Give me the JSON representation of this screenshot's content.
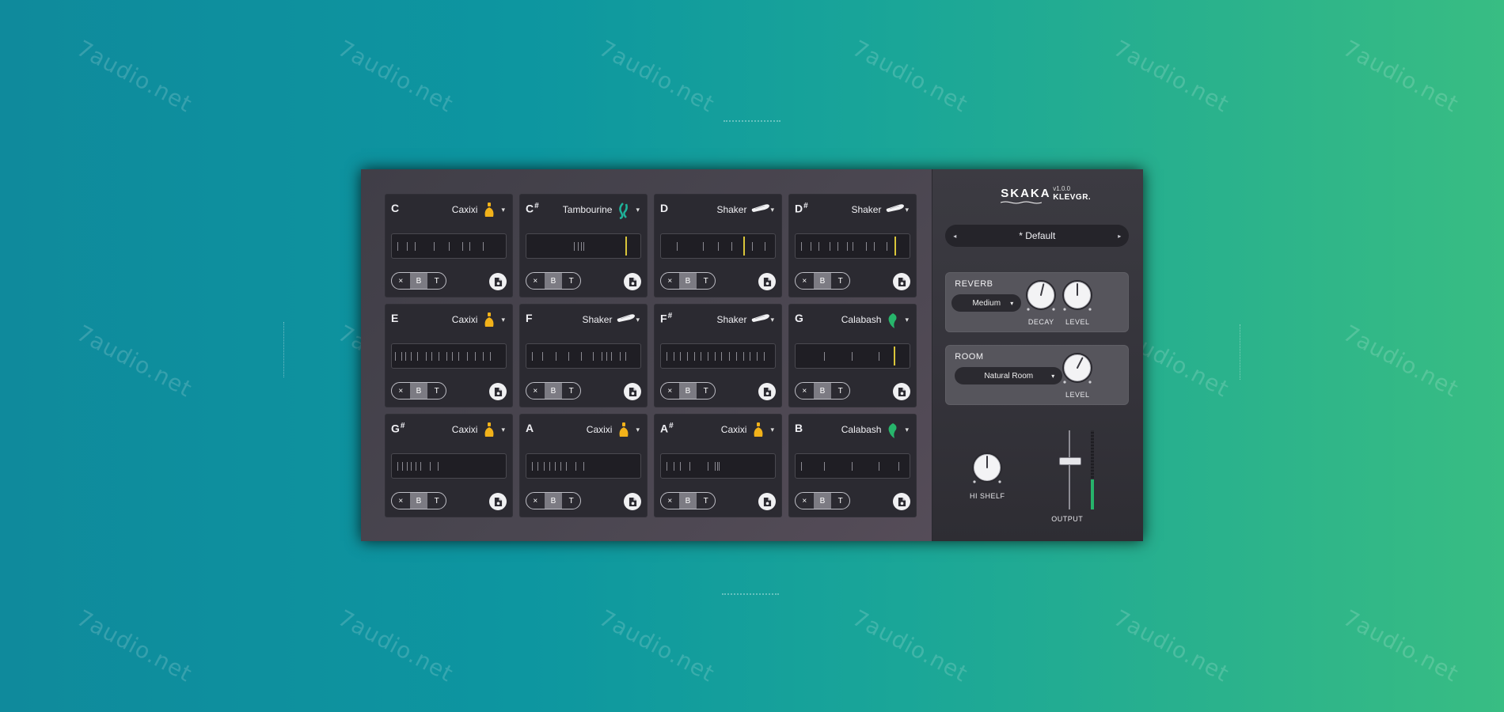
{
  "watermark": "7audio.net",
  "plugin": {
    "name": "SKAKA",
    "version": "v1.0.0",
    "brand": "KLEVGR.",
    "preset": {
      "name": "* Default",
      "prev_icon": "triangle-left-icon",
      "next_icon": "triangle-right-icon"
    }
  },
  "pads": [
    {
      "note": "C",
      "sharp": "",
      "instrument": "Caxixi",
      "icon": "caxixi-icon",
      "ticks": [
        0.05,
        0.13,
        0.2,
        0.37,
        0.5,
        0.62,
        0.68,
        0.8
      ],
      "playhead": null
    },
    {
      "note": "C",
      "sharp": "#",
      "instrument": "Tambourine",
      "icon": "tambourine-icon",
      "ticks": [
        0.42,
        0.45,
        0.48,
        0.5
      ],
      "playhead": 0.87
    },
    {
      "note": "D",
      "sharp": "",
      "instrument": "Shaker",
      "icon": "shaker-icon",
      "ticks": [
        0.14,
        0.37,
        0.5,
        0.62,
        0.8,
        0.91
      ],
      "playhead": 0.72
    },
    {
      "note": "D",
      "sharp": "#",
      "instrument": "Shaker",
      "icon": "shaker-icon",
      "ticks": [
        0.05,
        0.13,
        0.2,
        0.3,
        0.37,
        0.45,
        0.5,
        0.62,
        0.69,
        0.8
      ],
      "playhead": 0.87
    },
    {
      "note": "E",
      "sharp": "",
      "instrument": "Caxixi",
      "icon": "caxixi-icon",
      "ticks": [
        0.03,
        0.08,
        0.12,
        0.17,
        0.22,
        0.3,
        0.35,
        0.41,
        0.48,
        0.53,
        0.58,
        0.66,
        0.73,
        0.8,
        0.86
      ],
      "playhead": null
    },
    {
      "note": "F",
      "sharp": "",
      "instrument": "Shaker",
      "icon": "shaker-icon",
      "ticks": [
        0.05,
        0.14,
        0.26,
        0.37,
        0.48,
        0.58,
        0.66,
        0.7,
        0.74,
        0.82,
        0.87
      ],
      "playhead": null
    },
    {
      "note": "F",
      "sharp": "#",
      "instrument": "Shaker",
      "icon": "shaker-icon",
      "ticks": [
        0.05,
        0.11,
        0.17,
        0.23,
        0.29,
        0.35,
        0.41,
        0.47,
        0.53,
        0.6,
        0.66,
        0.72,
        0.78,
        0.84,
        0.9
      ],
      "playhead": null
    },
    {
      "note": "G",
      "sharp": "",
      "instrument": "Calabash",
      "icon": "calabash-icon",
      "ticks": [
        0.25,
        0.49,
        0.73,
        0.86
      ],
      "playhead": 0.86
    },
    {
      "note": "G",
      "sharp": "#",
      "instrument": "Caxixi",
      "icon": "caxixi-icon",
      "ticks": [
        0.05,
        0.09,
        0.13,
        0.17,
        0.21,
        0.25,
        0.33,
        0.4
      ],
      "playhead": null
    },
    {
      "note": "A",
      "sharp": "",
      "instrument": "Caxixi",
      "icon": "caxixi-icon",
      "ticks": [
        0.05,
        0.1,
        0.15,
        0.2,
        0.25,
        0.3,
        0.35,
        0.43,
        0.5
      ],
      "playhead": null
    },
    {
      "note": "A",
      "sharp": "#",
      "instrument": "Caxixi",
      "icon": "caxixi-icon",
      "ticks": [
        0.05,
        0.11,
        0.17,
        0.25,
        0.41,
        0.47,
        0.49,
        0.51
      ],
      "playhead": null
    },
    {
      "note": "B",
      "sharp": "",
      "instrument": "Calabash",
      "icon": "calabash-icon",
      "ticks": [
        0.05,
        0.25,
        0.49,
        0.73,
        0.9
      ],
      "playhead": null
    }
  ],
  "pad_buttons": {
    "mute": "×",
    "b": "B",
    "t": "T",
    "file_icon": "file-drag-icon",
    "caret": "▾"
  },
  "reverb": {
    "title": "REVERB",
    "type": "Medium",
    "decay_label": "DECAY",
    "level_label": "LEVEL",
    "decay": 0.55,
    "level": 0.5
  },
  "room": {
    "title": "ROOM",
    "type": "Natural Room",
    "level_label": "LEVEL",
    "level": 0.6
  },
  "hi_shelf": {
    "label": "HI SHELF",
    "value": 0.5
  },
  "output": {
    "label": "OUTPUT",
    "fader": 0.62,
    "meter": 0.38
  },
  "colors": {
    "caxixi": "#f2b21a",
    "tambourine": "#1fb39a",
    "calabash": "#27b56b",
    "shaker": "#f2f2f4",
    "playhead": "#d9c53a",
    "meter": "#27b36b"
  }
}
